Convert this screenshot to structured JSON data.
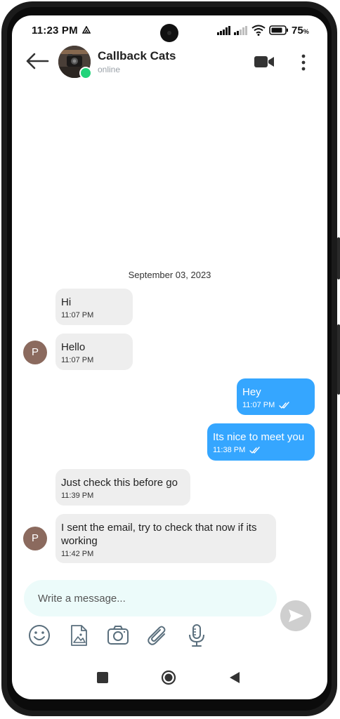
{
  "status_bar": {
    "time": "11:23 PM",
    "battery": "75"
  },
  "header": {
    "contact_name": "Callback Cats",
    "contact_status": "online"
  },
  "chat": {
    "date_separator": "September 03, 2023",
    "messages": [
      {
        "direction": "in",
        "text": "Hi",
        "time": "11:07 PM"
      },
      {
        "direction": "in",
        "text": "Hello",
        "time": "11:07 PM",
        "avatar_initial": "P"
      },
      {
        "direction": "out",
        "text": "Hey",
        "time": "11:07 PM"
      },
      {
        "direction": "out",
        "text": "Its nice to meet you",
        "time": "11:38 PM"
      },
      {
        "direction": "in",
        "text": "Just check this before go",
        "time": "11:39 PM"
      },
      {
        "direction": "in",
        "text": "I sent the email, try to check that now if its working",
        "time": "11:42 PM",
        "avatar_initial": "P"
      }
    ]
  },
  "composer": {
    "placeholder": "Write a message...",
    "value": ""
  },
  "toolbar_icons": [
    "emoji-icon",
    "image-file-icon",
    "camera-icon",
    "attachment-icon",
    "microphone-icon"
  ],
  "colors": {
    "outgoing_bubble": "#35a6ff",
    "incoming_bubble": "#eeeeee",
    "online_indicator": "#22d37a",
    "input_background": "#ecfbfa",
    "avatar_background": "#8b6a5e"
  }
}
